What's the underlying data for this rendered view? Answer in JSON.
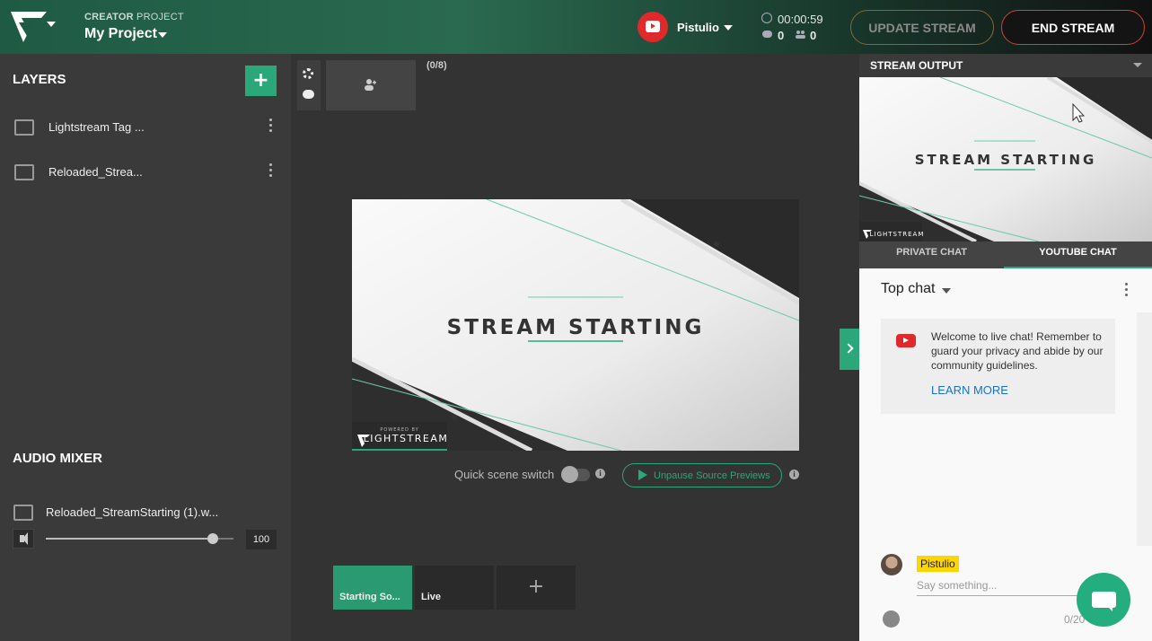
{
  "header": {
    "project_kicker_bold": "CREATOR",
    "project_kicker_light": "PROJECT",
    "project_name": "My Project",
    "channel_name": "Pistulio",
    "timer": "00:00:59",
    "chat_count": "0",
    "viewer_count": "0",
    "update_label": "UPDATE STREAM",
    "end_label": "END STREAM"
  },
  "layers": {
    "title": "LAYERS",
    "add_label": "+",
    "items": [
      {
        "label": "Lightstream Tag ...",
        "icon": "image-icon"
      },
      {
        "label": "Reloaded_Strea...",
        "icon": "film-icon"
      }
    ]
  },
  "audio": {
    "title": "AUDIO MIXER",
    "file_name": "Reloaded_StreamStarting (1).w...",
    "volume": 100
  },
  "center": {
    "guest_count": "(0/8)",
    "preview_title": "STREAM STARTING",
    "brand_powered": "POWERED BY",
    "brand_name": "LIGHTSTREAM",
    "quick_switch_label": "Quick scene switch",
    "unpause_label": "Unpause Source Previews",
    "scenes": [
      {
        "label": "Starting So...",
        "active": true
      },
      {
        "label": "Live",
        "active": false
      }
    ],
    "scene_add_label": "+"
  },
  "right": {
    "output_title": "STREAM OUTPUT",
    "tabs": {
      "private": "PRIVATE CHAT",
      "youtube": "YOUTUBE CHAT"
    },
    "topchat": "Top chat",
    "welcome": "Welcome to live chat! Remember to guard your privacy and abide by our community guidelines.",
    "learn_more": "LEARN MORE",
    "chat_user": "Pistulio",
    "input_placeholder": "Say something...",
    "char_count": "0/20"
  },
  "colors": {
    "accent": "#2aa879",
    "end_border": "#c9443a",
    "update_border": "#7d6a3a",
    "youtube_red": "#e0292b"
  }
}
